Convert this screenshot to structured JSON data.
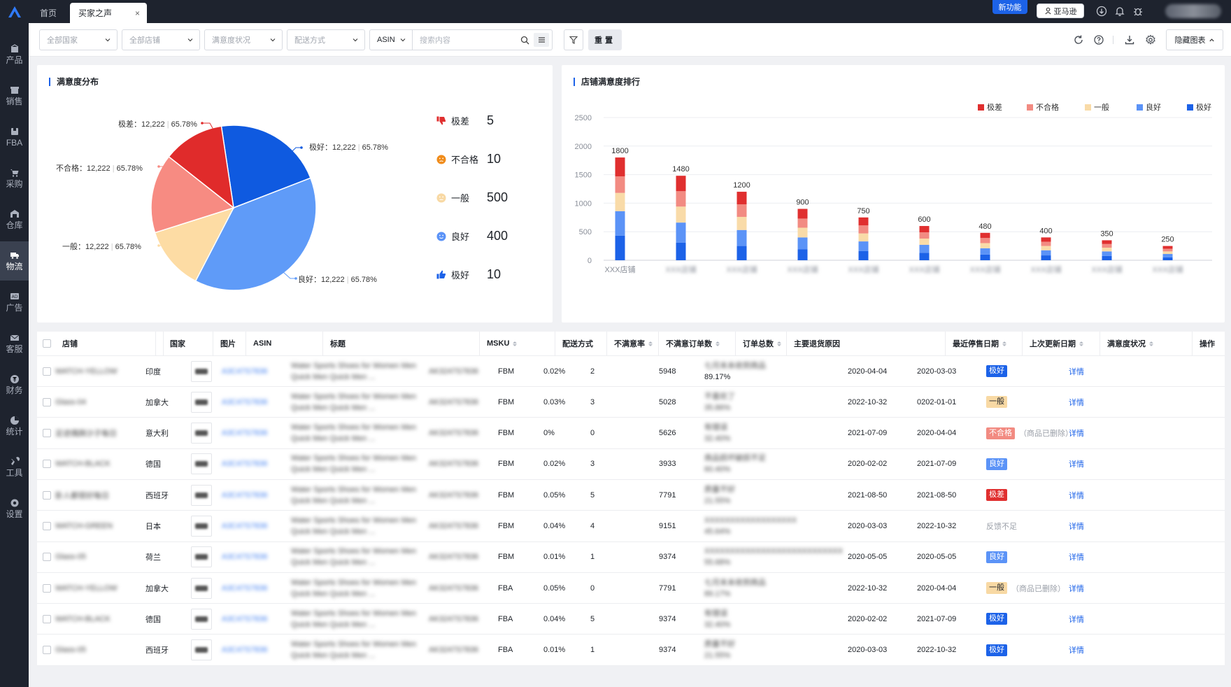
{
  "sidebar": {
    "items": [
      {
        "label": "产品",
        "icon": "box-icon"
      },
      {
        "label": "销售",
        "icon": "shop-icon"
      },
      {
        "label": "FBA",
        "icon": "package-icon"
      },
      {
        "label": "采购",
        "icon": "cart-icon"
      },
      {
        "label": "仓库",
        "icon": "warehouse-icon"
      },
      {
        "label": "物流",
        "icon": "truck-icon",
        "active": true
      },
      {
        "label": "广告",
        "icon": "ad-icon"
      },
      {
        "label": "客服",
        "icon": "mail-icon"
      },
      {
        "label": "财务",
        "icon": "yen-icon"
      },
      {
        "label": "统计",
        "icon": "pie-icon"
      },
      {
        "label": "工具",
        "icon": "wrench-icon"
      },
      {
        "label": "设置",
        "icon": "gear-icon"
      }
    ]
  },
  "topbar": {
    "tabs": [
      {
        "label": "首页"
      },
      {
        "label": "买家之声",
        "active": true
      }
    ],
    "new_feature": "新功能",
    "marketplace": "亚马逊"
  },
  "filters": {
    "country": "全部国家",
    "store": "全部店铺",
    "satisfaction": "满意度状况",
    "shipping": "配送方式",
    "search_type": "ASIN",
    "search_placeholder": "搜索内容",
    "reset": "重置",
    "hide_chart": "隐藏图表"
  },
  "pie_panel": {
    "title": "满意度分布",
    "callouts": [
      {
        "label": "极差：12,222",
        "pct": "65.78%"
      },
      {
        "label": "极好：12,222",
        "pct": "65.78%"
      },
      {
        "label": "不合格：12,222",
        "pct": "65.78%"
      },
      {
        "label": "一般：12,222",
        "pct": "65.78%"
      },
      {
        "label": "良好：12,222",
        "pct": "65.78%"
      }
    ],
    "legend": [
      {
        "label": "极差",
        "value": "5",
        "icon": "thumbs-down-icon",
        "color": "#e02f2f"
      },
      {
        "label": "不合格",
        "value": "10",
        "icon": "frown-face-icon",
        "color": "#f08c1b"
      },
      {
        "label": "一般",
        "value": "500",
        "icon": "neutral-face-icon",
        "color": "#f8d9a4"
      },
      {
        "label": "良好",
        "value": "400",
        "icon": "smile-face-icon",
        "color": "#5b93f7"
      },
      {
        "label": "极好",
        "value": "10",
        "icon": "thumbs-up-icon",
        "color": "#1c62e8"
      }
    ]
  },
  "chart_data": [
    {
      "type": "pie",
      "title": "满意度分布",
      "slices": [
        {
          "name": "极好",
          "value": 0.215,
          "color": "#0f5ae0"
        },
        {
          "name": "良好",
          "value": 0.385,
          "color": "#5f9bf8"
        },
        {
          "name": "一般",
          "value": 0.125,
          "color": "#fddca4"
        },
        {
          "name": "不合格",
          "value": 0.155,
          "color": "#f78b82"
        },
        {
          "name": "极差",
          "value": 0.12,
          "color": "#e02b2b"
        }
      ]
    },
    {
      "type": "bar",
      "stacked": true,
      "title": "店铺满意度排行",
      "categories": [
        "XXX店铺",
        "",
        "",
        "",
        "",
        "",
        "",
        "",
        "",
        ""
      ],
      "totals": [
        1800,
        1480,
        1200,
        900,
        750,
        600,
        480,
        400,
        350,
        250
      ],
      "ylim": [
        0,
        2500
      ],
      "yticks": [
        0,
        500,
        1000,
        1500,
        2000,
        2500
      ],
      "legend_position": "top-right",
      "series": [
        {
          "name": "极好",
          "color": "#1c62e8",
          "values": [
            430,
            310,
            250,
            190,
            160,
            130,
            100,
            85,
            75,
            50
          ]
        },
        {
          "name": "良好",
          "color": "#5b93f7",
          "values": [
            430,
            350,
            280,
            210,
            170,
            140,
            110,
            90,
            80,
            60
          ]
        },
        {
          "name": "一般",
          "color": "#f9dba8",
          "values": [
            320,
            280,
            230,
            170,
            140,
            110,
            90,
            75,
            65,
            45
          ]
        },
        {
          "name": "不合格",
          "color": "#f28b82",
          "values": [
            290,
            270,
            220,
            160,
            140,
            110,
            90,
            75,
            65,
            45
          ]
        },
        {
          "name": "极差",
          "color": "#e02f2f",
          "values": [
            330,
            270,
            220,
            170,
            140,
            110,
            90,
            75,
            65,
            50
          ]
        }
      ]
    }
  ],
  "bar_panel": {
    "title": "店铺满意度排行",
    "legend": [
      {
        "label": "极差",
        "color": "#e02f2f"
      },
      {
        "label": "不合格",
        "color": "#f28b82"
      },
      {
        "label": "一般",
        "color": "#f9dba8"
      },
      {
        "label": "良好",
        "color": "#5b93f7"
      },
      {
        "label": "极好",
        "color": "#1c62e8"
      }
    ]
  },
  "table": {
    "headers": {
      "store": "店铺",
      "country": "国家",
      "image": "图片",
      "asin": "ASIN",
      "title": "标题",
      "msku": "MSKU",
      "shipping": "配送方式",
      "unsat_rate": "不满意率",
      "unsat_orders": "不满意订单数",
      "orders": "订单总数",
      "reason": "主要退货原因",
      "last_stop": "最近停售日期",
      "last_update": "上次更新日期",
      "status": "满意度状况",
      "action": "操作"
    },
    "rows": [
      {
        "store": "WATCH-YELLOW",
        "country": "印度",
        "asin": "A3C47S7836",
        "title1": "Water Sports Shoes for Women Men",
        "title2": "Quick Men Quick Men ...",
        "msku": "AK3247S7836",
        "shipping": "FBM",
        "rate": "0.02%",
        "unsat": "2",
        "orders": "5948",
        "reason": "七月末未收到商品",
        "reason_pct": "89.17%",
        "stop": "2020-04-04",
        "update": "2020-03-03",
        "status": "极好",
        "status_cls": "g-best",
        "note": "",
        "action": "详情"
      },
      {
        "store": "Glass-04",
        "country": "加拿大",
        "asin": "A3C47S7836",
        "title1": "Water Sports Shoes for Women Men",
        "title2": "Quick Men Quick Men ...",
        "msku": "AK3247S7836",
        "shipping": "FBM",
        "rate": "0.03%",
        "unsat": "3",
        "orders": "5028",
        "reason": "不喜欢了",
        "reason_pct": "35.86%",
        "stop": "2022-10-32",
        "update": "0202-01-01",
        "status": "一般",
        "status_cls": "g-norm",
        "note": "",
        "action": "详情"
      },
      {
        "store": "足迹偶蹄沙子每日",
        "country": "意大利",
        "asin": "A3C47S7836",
        "title1": "Water Sports Shoes for Women Men",
        "title2": "Quick Men Quick Men ...",
        "msku": "AK3247S7836",
        "shipping": "FBM",
        "rate": "0%",
        "unsat": "0",
        "orders": "5626",
        "reason": "有错误",
        "reason_pct": "32.40%",
        "stop": "2021-07-09",
        "update": "2020-04-04",
        "status": "不合格",
        "status_cls": "g-bad",
        "note": "（商品已删除）",
        "action": "详情"
      },
      {
        "store": "WATCH-BLACK",
        "country": "德国",
        "asin": "A3C47S7836",
        "title1": "Water Sports Shoes for Women Men",
        "title2": "Quick Men Quick Men ...",
        "msku": "AK3247S7836",
        "shipping": "FBM",
        "rate": "0.02%",
        "unsat": "3",
        "orders": "3933",
        "reason": "商品损坏破损不足",
        "reason_pct": "60.40%",
        "stop": "2020-02-02",
        "update": "2021-07-09",
        "status": "良好",
        "status_cls": "g-good",
        "note": "",
        "action": "详情"
      },
      {
        "store": "卧人都很好每日",
        "country": "西班牙",
        "asin": "A3C47S7836",
        "title1": "Water Sports Shoes for Women Men",
        "title2": "Quick Men Quick Men ...",
        "msku": "AK3247S7836",
        "shipping": "FBM",
        "rate": "0.05%",
        "unsat": "5",
        "orders": "7791",
        "reason": "质量不好",
        "reason_pct": "21.55%",
        "stop": "2021-08-50",
        "update": "2021-08-50",
        "status": "极差",
        "status_cls": "g-worst",
        "note": "",
        "action": "详情"
      },
      {
        "store": "WATCH-GREEN",
        "country": "日本",
        "asin": "A3C47S7836",
        "title1": "Water Sports Shoes for Women Men",
        "title2": "Quick Men Quick Men ...",
        "msku": "AK3247S7836",
        "shipping": "FBM",
        "rate": "0.04%",
        "unsat": "4",
        "orders": "9151",
        "reason": "XXXXXXXXXXXXXXXXXX",
        "reason_pct": "45.64%",
        "stop": "2020-03-03",
        "update": "2022-10-32",
        "status": "反馈不足",
        "status_cls": "",
        "note": "",
        "action": "详情"
      },
      {
        "store": "Glass-05",
        "country": "荷兰",
        "asin": "A3C47S7836",
        "title1": "Water Sports Shoes for Women Men",
        "title2": "Quick Men Quick Men ...",
        "msku": "AK3247S7836",
        "shipping": "FBM",
        "rate": "0.01%",
        "unsat": "1",
        "orders": "9374",
        "reason": "XXXXXXXXXXXXXXXXXXXXXXXXXXX",
        "reason_pct": "55.68%",
        "stop": "2020-05-05",
        "update": "2020-05-05",
        "status": "良好",
        "status_cls": "g-good",
        "note": "",
        "action": "详情"
      },
      {
        "store": "WATCH-YELLOW",
        "country": "加拿大",
        "asin": "A3C47S7836",
        "title1": "Water Sports Shoes for Women Men",
        "title2": "Quick Men Quick Men ...",
        "msku": "AK3247S7836",
        "shipping": "FBA",
        "rate": "0.05%",
        "unsat": "0",
        "orders": "7791",
        "reason": "七月末未收到商品",
        "reason_pct": "89.17%",
        "stop": "2022-10-32",
        "update": "2020-04-04",
        "status": "一般",
        "status_cls": "g-norm",
        "note": "（商品已删除）",
        "action": "详情"
      },
      {
        "store": "WATCH-BLACK",
        "country": "德国",
        "asin": "A3C47S7836",
        "title1": "Water Sports Shoes for Women Men",
        "title2": "Quick Men Quick Men ...",
        "msku": "AK3247S7836",
        "shipping": "FBA",
        "rate": "0.04%",
        "unsat": "5",
        "orders": "9374",
        "reason": "有错误",
        "reason_pct": "32.40%",
        "stop": "2020-02-02",
        "update": "2021-07-09",
        "status": "极好",
        "status_cls": "g-best",
        "note": "",
        "action": "详情"
      },
      {
        "store": "Glass-05",
        "country": "西班牙",
        "asin": "A3C47S7836",
        "title1": "Water Sports Shoes for Women Men",
        "title2": "Quick Men Quick Men ...",
        "msku": "AK3247S7836",
        "shipping": "FBA",
        "rate": "0.01%",
        "unsat": "1",
        "orders": "9374",
        "reason": "质量不好",
        "reason_pct": "21.55%",
        "stop": "2020-03-03",
        "update": "2022-10-32",
        "status": "极好",
        "status_cls": "g-best",
        "note": "",
        "action": "详情"
      }
    ]
  }
}
